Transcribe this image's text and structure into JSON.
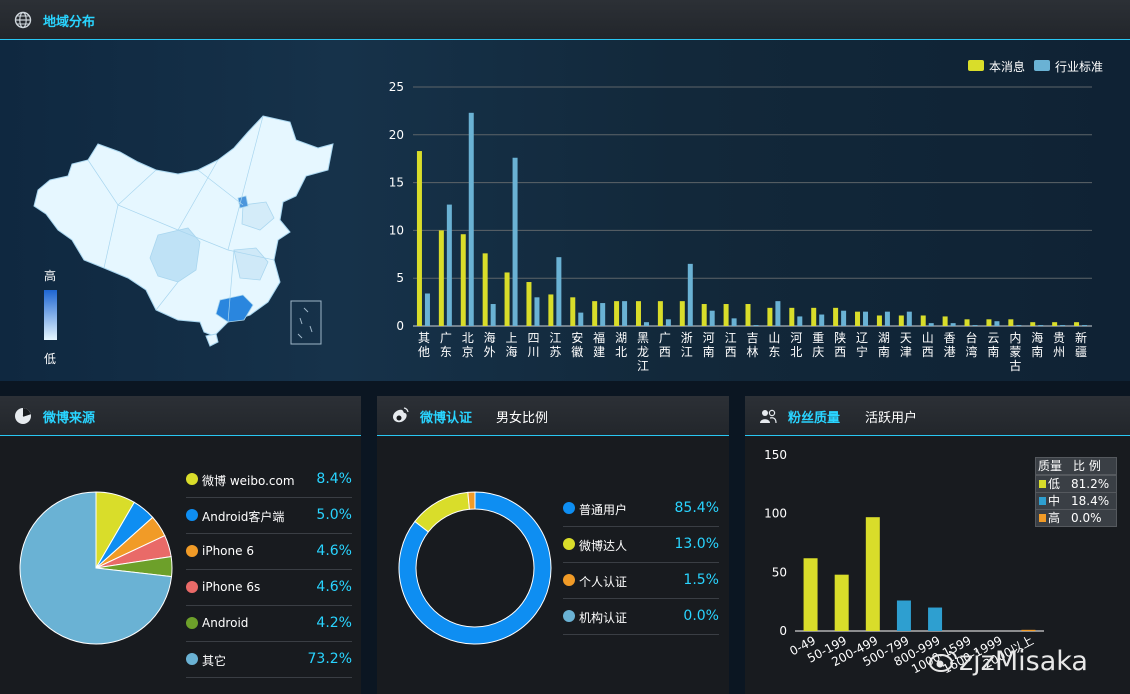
{
  "colors": {
    "yellow": "#d9dd2a",
    "steel": "#6ab2d4",
    "blue": "#0e8ef2",
    "orange": "#f19b27",
    "red": "#e96a68",
    "green": "#6da02a",
    "cyan": "#29d4ff",
    "mapLight": "#e6f7ff",
    "mapDark": "#1e66d2"
  },
  "region": {
    "title": "地域分布",
    "map_scale_high": "高",
    "map_scale_low": "低",
    "legend": [
      "本消息",
      "行业标准"
    ],
    "chart_data": {
      "type": "bar",
      "categories": [
        "其他",
        "广东",
        "北京",
        "海外",
        "上海",
        "四川",
        "江苏",
        "安徽",
        "福建",
        "湖北",
        "黑龙江",
        "广西",
        "浙江",
        "河南",
        "江西",
        "吉林",
        "山东",
        "河北",
        "重庆",
        "陕西",
        "辽宁",
        "湖南",
        "天津",
        "山西",
        "香港",
        "台湾",
        "云南",
        "内蒙古",
        "海南",
        "贵州",
        "新疆"
      ],
      "series": [
        {
          "name": "本消息",
          "values": [
            18.3,
            10.0,
            9.6,
            7.6,
            5.6,
            4.6,
            3.3,
            3.0,
            2.6,
            2.6,
            2.6,
            2.6,
            2.6,
            2.3,
            2.3,
            2.3,
            1.9,
            1.9,
            1.9,
            1.9,
            1.5,
            1.1,
            1.1,
            1.1,
            1.0,
            0.7,
            0.7,
            0.7,
            0.4,
            0.4,
            0.4
          ]
        },
        {
          "name": "行业标准",
          "values": [
            3.4,
            12.7,
            22.3,
            2.3,
            17.6,
            3.0,
            7.2,
            1.4,
            2.4,
            2.6,
            0.4,
            0.7,
            6.5,
            1.6,
            0.8,
            0.1,
            2.6,
            1.0,
            1.2,
            1.6,
            1.5,
            1.5,
            1.5,
            0.3,
            0.3,
            0.1,
            0.5,
            0.1,
            0.1,
            0.1,
            0.1
          ]
        }
      ],
      "ylim": [
        0,
        25
      ],
      "yticks": [
        0,
        5,
        10,
        15,
        20,
        25
      ]
    }
  },
  "source": {
    "title": "微博来源",
    "items": [
      {
        "label": "微博 weibo.com",
        "pct": "8.4%",
        "value": 8.4,
        "color": "#d9dd2a"
      },
      {
        "label": "Android客户端",
        "pct": "5.0%",
        "value": 5.0,
        "color": "#0e8ef2"
      },
      {
        "label": "iPhone 6",
        "pct": "4.6%",
        "value": 4.6,
        "color": "#f19b27"
      },
      {
        "label": "iPhone 6s",
        "pct": "4.6%",
        "value": 4.6,
        "color": "#e96a68"
      },
      {
        "label": "Android",
        "pct": "4.2%",
        "value": 4.2,
        "color": "#6da02a"
      },
      {
        "label": "其它",
        "pct": "73.2%",
        "value": 73.2,
        "color": "#6ab2d4"
      }
    ]
  },
  "verify": {
    "title": "微博认证",
    "tab": "男女比例",
    "items": [
      {
        "label": "普通用户",
        "pct": "85.4%",
        "value": 85.4,
        "color": "#0e8ef2"
      },
      {
        "label": "微博达人",
        "pct": "13.0%",
        "value": 13.0,
        "color": "#d9dd2a"
      },
      {
        "label": "个人认证",
        "pct": "1.5%",
        "value": 1.5,
        "color": "#f19b27"
      },
      {
        "label": "机构认证",
        "pct": "0.0%",
        "value": 0.0,
        "color": "#6ab2d4"
      }
    ]
  },
  "fans": {
    "title": "粉丝质量",
    "tab": "活跃用户",
    "table": {
      "headers": [
        "质量",
        "比 例"
      ],
      "rows": [
        {
          "k": "低",
          "v": "81.2%",
          "color": "#d9dd2a"
        },
        {
          "k": "中",
          "v": "18.4%",
          "color": "#2e9fd0"
        },
        {
          "k": "高",
          "v": "0.0%",
          "color": "#f19b27"
        }
      ]
    },
    "chart_data": {
      "type": "bar",
      "categories": [
        "0-49",
        "50-199",
        "200-499",
        "500-799",
        "800-999",
        "1000-1599",
        "1600-1999",
        "2000以上"
      ],
      "values": [
        62,
        48,
        97,
        26,
        20,
        0,
        0,
        1
      ],
      "colors": [
        "#d9dd2a",
        "#d9dd2a",
        "#d9dd2a",
        "#2e9fd0",
        "#2e9fd0",
        "#2e9fd0",
        "#f19b27",
        "#f19b27"
      ],
      "ylim": [
        0,
        150
      ],
      "yticks": [
        0,
        50,
        100,
        150
      ]
    },
    "watermark": "zjzMisaka"
  }
}
